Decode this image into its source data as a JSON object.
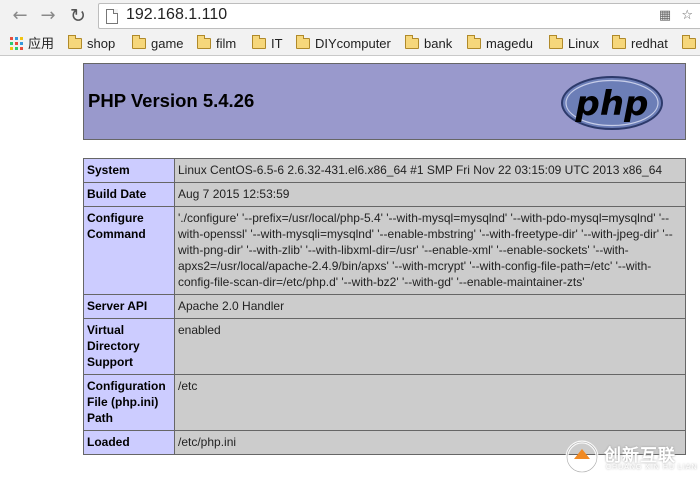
{
  "browser": {
    "url": "192.168.1.110",
    "icons": [
      "back-arrow-icon",
      "forward-arrow-icon",
      "reload-icon",
      "page-icon",
      "translate-icon",
      "star-icon"
    ]
  },
  "bookmarks": [
    {
      "label": "应用",
      "icon": "apps-grid-icon"
    },
    {
      "label": "shop",
      "icon": "folder-icon"
    },
    {
      "label": "game",
      "icon": "folder-icon"
    },
    {
      "label": "film",
      "icon": "folder-icon"
    },
    {
      "label": "IT",
      "icon": "folder-icon"
    },
    {
      "label": "DIYcomputer",
      "icon": "folder-icon"
    },
    {
      "label": "bank",
      "icon": "folder-icon"
    },
    {
      "label": "magedu",
      "icon": "folder-icon"
    },
    {
      "label": "Linux",
      "icon": "folder-icon"
    },
    {
      "label": "redhat",
      "icon": "folder-icon"
    }
  ],
  "header": {
    "title": "PHP Version 5.4.26",
    "logo_text": "php"
  },
  "info_rows": [
    {
      "key": "System",
      "value": "Linux CentOS-6.5-6 2.6.32-431.el6.x86_64 #1 SMP Fri Nov 22 03:15:09 UTC 2013 x86_64"
    },
    {
      "key": "Build Date",
      "value": "Aug 7 2015 12:53:59"
    },
    {
      "key": "Configure Command",
      "value": "'./configure' '--prefix=/usr/local/php-5.4' '--with-mysql=mysqlnd' '--with-pdo-mysql=mysqlnd' '--with-openssl' '--with-mysqli=mysqlnd' '--enable-mbstring' '--with-freetype-dir' '--with-jpeg-dir' '--with-png-dir' '--with-zlib' '--with-libxml-dir=/usr' '--enable-xml' '--enable-sockets' '--with-apxs2=/usr/local/apache-2.4.9/bin/apxs' '--with-mcrypt' '--with-config-file-path=/etc' '--with-config-file-scan-dir=/etc/php.d' '--with-bz2' '--with-gd' '--enable-maintainer-zts'"
    },
    {
      "key": "Server API",
      "value": "Apache 2.0 Handler"
    },
    {
      "key": "Virtual Directory Support",
      "value": "enabled"
    },
    {
      "key": "Configuration File (php.ini) Path",
      "value": "/etc"
    },
    {
      "key": "Loaded",
      "value": "/etc/php.ini"
    }
  ],
  "watermark": {
    "text": "创新互联",
    "subtext": "CHUANG XIN HU LIAN"
  },
  "colors": {
    "header_bg": "#9999cc",
    "key_bg": "#ccccff",
    "value_bg": "#cccccc"
  }
}
